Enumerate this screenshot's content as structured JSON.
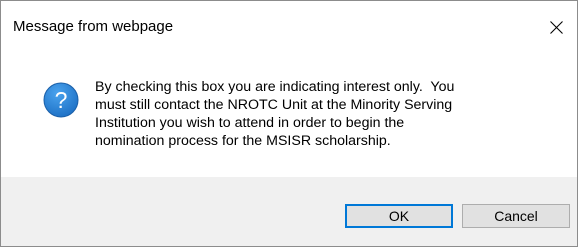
{
  "dialog": {
    "title": "Message from webpage",
    "close_icon": "close-icon",
    "message_icon": "question-icon",
    "message_lines": [
      "By checking this box you are indicating interest only.  You",
      "must still contact the NROTC Unit at the Minority Serving",
      "Institution you wish to attend in order to begin the",
      "nomination process for the MSISR scholarship."
    ],
    "buttons": {
      "ok_label": "OK",
      "cancel_label": "Cancel"
    },
    "colors": {
      "icon_fill": "#1c6fc4",
      "focus_border": "#0078d7",
      "footer_background": "#f0f0f0"
    }
  }
}
